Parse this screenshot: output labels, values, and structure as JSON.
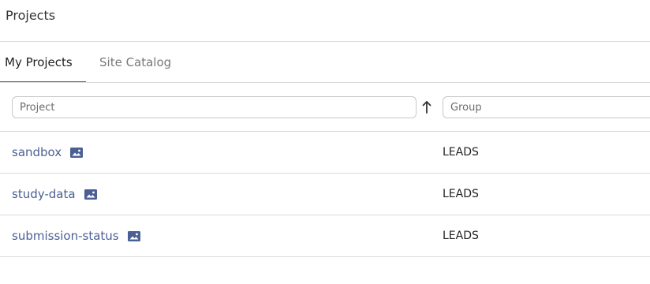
{
  "page": {
    "title": "Projects"
  },
  "tabs": [
    {
      "label": "My Projects",
      "active": true
    },
    {
      "label": "Site Catalog",
      "active": false
    }
  ],
  "filters": {
    "project_placeholder": "Project",
    "group_placeholder": "Group",
    "sort_direction": "ascending"
  },
  "rows": [
    {
      "project": "sandbox",
      "group": "LEADS",
      "icon": "image-icon"
    },
    {
      "project": "study-data",
      "group": "LEADS",
      "icon": "image-icon"
    },
    {
      "project": "submission-status",
      "group": "LEADS",
      "icon": "image-icon"
    }
  ],
  "colors": {
    "accent": "#3a6fd8",
    "link": "#4a5f94",
    "divider": "#d9d9d9"
  }
}
